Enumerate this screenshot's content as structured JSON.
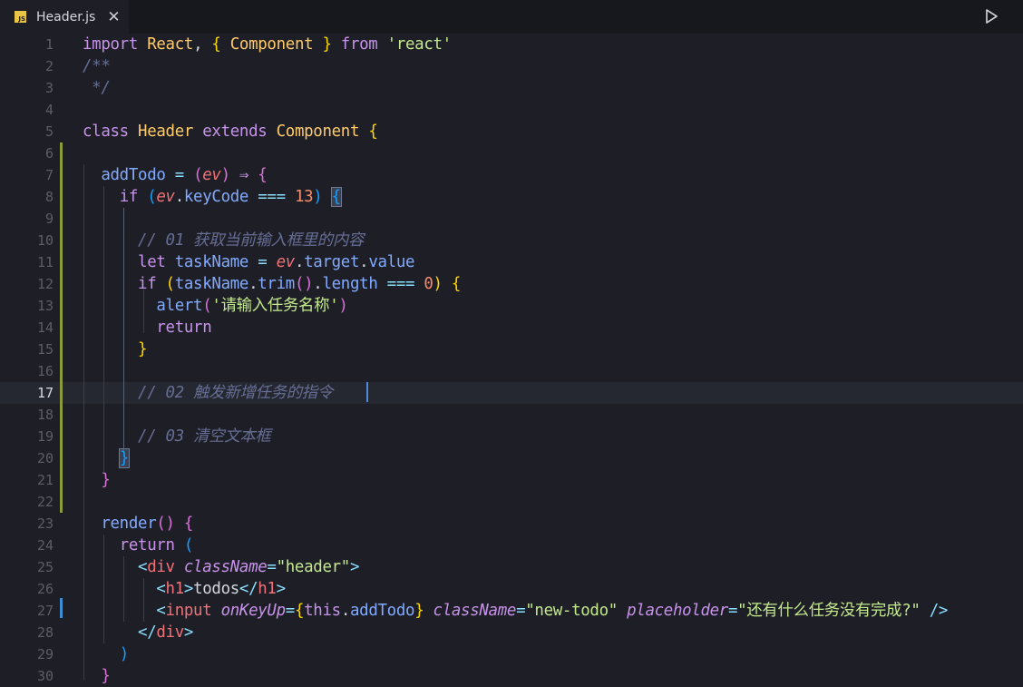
{
  "tab": {
    "title": "Header.js",
    "icon_label": "JS",
    "close_glyph": "✕"
  },
  "editor": {
    "active_line": 17,
    "lines": [
      {
        "n": "1",
        "html": "<span class='kw'>import</span> <span class='cls'>React</span>, <span class='b1'>{</span> <span class='cls'>Component</span> <span class='b1'>}</span> <span class='kw'>from</span> <span class='str'>'react'</span>"
      },
      {
        "n": "2",
        "html": "<span class='cm'>/**</span>"
      },
      {
        "n": "3",
        "html": "<span class='cm'> */</span>"
      },
      {
        "n": "4",
        "html": ""
      },
      {
        "n": "5",
        "html": "<span class='kw'>class</span> <span class='cls'>Header</span> <span class='kw'>extends</span> <span class='cls'>Component</span> <span class='b1'>{</span>"
      },
      {
        "n": "6",
        "html": ""
      },
      {
        "n": "7",
        "html": "  <span class='fn'>addTodo</span> <span class='op'>=</span> <span class='b2'>(</span><span class='prm'>ev</span><span class='b2'>)</span> <span class='kw'>⇒</span> <span class='b2'>{</span>"
      },
      {
        "n": "8",
        "html": "    <span class='kw'>if</span> <span class='b3'>(</span><span class='prm'>ev</span>.<span class='fn'>keyCode</span> <span class='op'>===</span> <span class='num'>13</span><span class='b3'>)</span> <span class='b3 brk'>{</span>"
      },
      {
        "n": "9",
        "html": ""
      },
      {
        "n": "10",
        "html": "      <span class='cm'>// 01 获取当前输入框里的内容</span>"
      },
      {
        "n": "11",
        "html": "      <span class='kw'>let</span> <span class='fn'>taskName</span> <span class='op'>=</span> <span class='prm'>ev</span>.<span class='fn'>target</span>.<span class='fn'>value</span>"
      },
      {
        "n": "12",
        "html": "      <span class='kw'>if</span> <span class='b1'>(</span><span class='fn'>taskName</span>.<span class='fn'>trim</span><span class='b2'>()</span>.<span class='fn'>length</span> <span class='op'>===</span> <span class='num'>0</span><span class='b1'>)</span> <span class='b1'>{</span>"
      },
      {
        "n": "13",
        "html": "        <span class='fn'>alert</span><span class='b2'>(</span><span class='str'>'请输入任务名称'</span><span class='b2'>)</span>"
      },
      {
        "n": "14",
        "html": "        <span class='kw'>return</span>"
      },
      {
        "n": "15",
        "html": "      <span class='b1'>}</span>"
      },
      {
        "n": "16",
        "html": ""
      },
      {
        "n": "17",
        "html": "      <span class='cm'>// 02 触发新增任务的指令</span>"
      },
      {
        "n": "18",
        "html": ""
      },
      {
        "n": "19",
        "html": "      <span class='cm'>// 03 清空文本框</span>"
      },
      {
        "n": "20",
        "html": "    <span class='b3 brk'>}</span>"
      },
      {
        "n": "21",
        "html": "  <span class='b2'>}</span>"
      },
      {
        "n": "22",
        "html": ""
      },
      {
        "n": "23",
        "html": "  <span class='fn'>render</span><span class='b2'>()</span> <span class='b2'>{</span>"
      },
      {
        "n": "24",
        "html": "    <span class='kw'>return</span> <span class='b3'>(</span>"
      },
      {
        "n": "25",
        "html": "      <span class='pn'>&lt;</span><span class='tag'>div</span> <span class='attr'>className</span><span class='op'>=</span><span class='str'>\"header\"</span><span class='pn'>&gt;</span>"
      },
      {
        "n": "26",
        "html": "        <span class='pn'>&lt;</span><span class='tag'>h1</span><span class='pn'>&gt;</span>todos<span class='pn'>&lt;/</span><span class='tag'>h1</span><span class='pn'>&gt;</span>"
      },
      {
        "n": "27",
        "html": "        <span class='pn'>&lt;</span><span class='tag'>input</span> <span class='attr'>onKeyUp</span><span class='op'>=</span><span class='b1'>{</span><span class='kw'>this</span>.<span class='fn'>addTodo</span><span class='b1'>}</span> <span class='attr'>className</span><span class='op'>=</span><span class='str'>\"new-todo\"</span> <span class='attr'>placeholder</span><span class='op'>=</span><span class='str'>\"还有什么任务没有完成?\"</span> <span class='pn'>/&gt;</span>"
      },
      {
        "n": "28",
        "html": "      <span class='pn'>&lt;/</span><span class='tag'>div</span><span class='pn'>&gt;</span>"
      },
      {
        "n": "29",
        "html": "    <span class='b3'>)</span>"
      },
      {
        "n": "30",
        "html": "  <span class='b2'>}</span>"
      }
    ]
  },
  "colors": {
    "background": "#1e1f26",
    "tabbar": "#17181d",
    "gutter_modified": "#8a9a3c",
    "gutter_changed": "#3f8fd0",
    "cursor": "#4f8ad9"
  }
}
